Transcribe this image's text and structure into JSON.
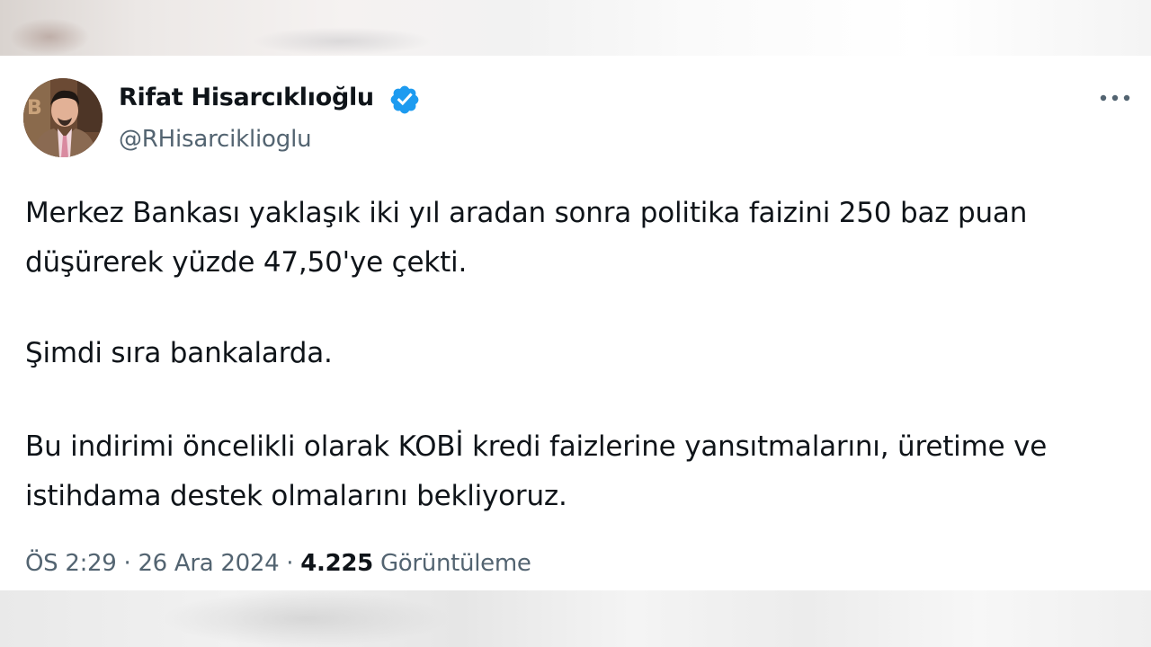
{
  "author": {
    "display_name": "Rifat Hisarcıklıoğlu",
    "handle": "@RHisarciklioglu",
    "verified": true
  },
  "tweet": {
    "paragraph_1_line_1": "Merkez Bankası yaklaşık iki yıl aradan sonra politika faizini 250 baz puan",
    "paragraph_1_line_2": "düşürerek yüzde 47,50'ye çekti.",
    "paragraph_2": "Şimdi sıra bankalarda.",
    "paragraph_3_line_1": "Bu indirimi öncelikli olarak KOBİ kredi faizlerine yansıtmalarını, üretime ve",
    "paragraph_3_line_2": "istihdama destek olmalarını bekliyoruz."
  },
  "meta": {
    "time": "ÖS 2:29",
    "separator": "·",
    "date": "26 Ara 2024",
    "views_count": "4.225",
    "views_label": "Görüntüleme"
  },
  "icons": {
    "verified": "verified-badge-icon",
    "more": "more-horizontal-icon"
  },
  "colors": {
    "text_primary": "#0f1419",
    "text_secondary": "#536471",
    "verified_blue": "#1d9bf0"
  }
}
